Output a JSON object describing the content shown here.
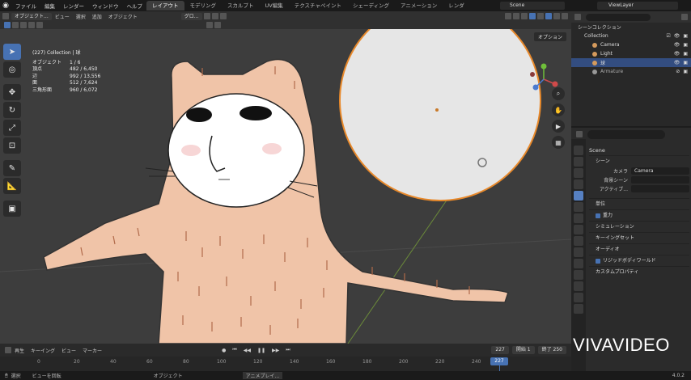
{
  "menu": {
    "items": [
      "ファイル",
      "編集",
      "レンダー",
      "ウィンドウ",
      "ヘルプ"
    ],
    "workspaces": [
      "レイアウト",
      "モデリング",
      "スカルプト",
      "UV編集",
      "テクスチャペイント",
      "シェーディング",
      "アニメーション",
      "レンダ"
    ],
    "active_workspace": "レイアウト",
    "scene": "Scene",
    "view_layer": "ViewLayer"
  },
  "viewport_header": {
    "mode": "オブジェクト...",
    "menus": [
      "ビュー",
      "選択",
      "追加",
      "オブジェクト"
    ],
    "transform": "グロ...",
    "options": "オプション"
  },
  "stats": {
    "view_title": "",
    "collection": "(227) Collection | 球",
    "rows": [
      {
        "label": "オブジェクト",
        "value": "1 / 6"
      },
      {
        "label": "頂点",
        "value": "482 / 6,450"
      },
      {
        "label": "辺",
        "value": "992 / 13,556"
      },
      {
        "label": "面",
        "value": "512 / 7,624"
      },
      {
        "label": "三角形面",
        "value": "960 / 6,072"
      }
    ]
  },
  "outliner": {
    "root": "シーンコレクション",
    "items": [
      {
        "name": "Collection",
        "color": "#cfcfcf"
      },
      {
        "name": "Camera",
        "color": "#d49a5c"
      },
      {
        "name": "Light",
        "color": "#d49a5c"
      },
      {
        "name": "球",
        "color": "#d49a5c"
      },
      {
        "name": "Armature",
        "color": "#999999"
      }
    ]
  },
  "properties": {
    "search_placeholder": "",
    "scene_name": "Scene",
    "section_scene": "シーン",
    "camera_label": "カメラ",
    "camera_value": "Camera",
    "bg_scene_label": "背景シーン",
    "active_clip_label": "アクティブ...",
    "panels": [
      "単位",
      "重力",
      "シミュレーション",
      "キーイングセット",
      "オーディオ",
      "リジッドボディワールド",
      "カスタムプロパティ"
    ]
  },
  "timeline": {
    "menus": [
      "再生",
      "キーイング",
      "ビュー",
      "マーカー"
    ],
    "current_frame": "227",
    "start_label": "開始",
    "start_value": "1",
    "end_label": "終了",
    "end_value": "250",
    "ticks": [
      "0",
      "20",
      "40",
      "60",
      "80",
      "100",
      "120",
      "140",
      "160",
      "180",
      "200",
      "220",
      "240"
    ],
    "playhead_label": "227"
  },
  "statusbar": {
    "items": [
      "選択",
      "ビューを回転",
      "オブジェクト",
      "アニメプレイ..."
    ],
    "version": "4.0.2"
  },
  "watermark": "VIVAVIDEO"
}
